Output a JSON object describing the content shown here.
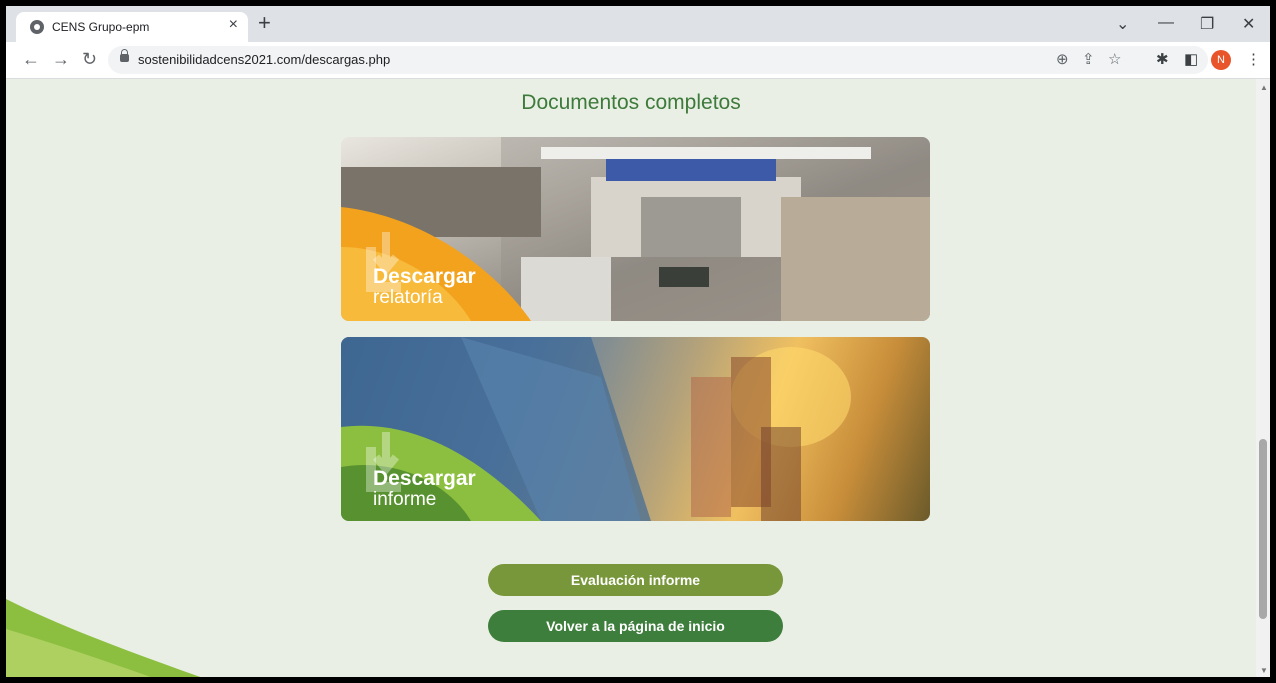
{
  "browser": {
    "tab_title": "CENS Grupo-epm",
    "tab_close": "×",
    "new_tab": "+",
    "url": "sostenibilidadcens2021.com/descargas.php",
    "profile_initial": "N",
    "icons": [
      "back-icon",
      "forward-icon",
      "reload-icon",
      "lock-icon",
      "zoom-icon",
      "share-icon",
      "star-icon",
      "extensions-icon",
      "sidepanel-icon",
      "menu-icon"
    ]
  },
  "page": {
    "title": "Documentos completos",
    "banner_relatoria": {
      "line1": "Descargar",
      "line2": "relatoría"
    },
    "banner_informe": {
      "line1": "Descargar",
      "line2": "informe"
    },
    "buttons": {
      "evaluacion": "Evaluación informe",
      "volver": "Volver a la página de inicio"
    }
  },
  "colors": {
    "background": "#e9efe4",
    "title_green": "#3d7a3b",
    "button_olive": "#78963a",
    "button_green": "#3e7e3c",
    "accent_orange": "#f2a21d",
    "accent_lime": "#8cbf3f"
  }
}
